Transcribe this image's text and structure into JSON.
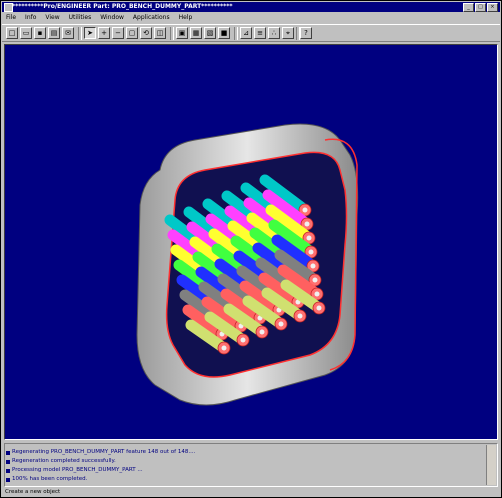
{
  "window": {
    "title": "**********Pro/ENGINEER Part: PRO_BENCH_DUMMY_PART**********",
    "controls": [
      "_",
      "□",
      "×"
    ]
  },
  "menubar": [
    "File",
    "Info",
    "View",
    "Utilities",
    "Window",
    "Applications",
    "Help"
  ],
  "toolbar": {
    "buttons": [
      {
        "name": "new-icon",
        "glyph": "□"
      },
      {
        "name": "open-icon",
        "glyph": "▭"
      },
      {
        "name": "save-icon",
        "glyph": "▪"
      },
      {
        "name": "print-icon",
        "glyph": "▤"
      },
      {
        "name": "mail-icon",
        "glyph": "✉"
      },
      {
        "name": "select-arrow-icon",
        "glyph": "➤"
      },
      {
        "name": "zoom-in-icon",
        "glyph": "+"
      },
      {
        "name": "zoom-out-icon",
        "glyph": "−"
      },
      {
        "name": "refit-icon",
        "glyph": "▢"
      },
      {
        "name": "orient-icon",
        "glyph": "⟲"
      },
      {
        "name": "saved-view-icon",
        "glyph": "◫"
      },
      {
        "name": "wireframe-icon",
        "glyph": "▣"
      },
      {
        "name": "hidden-line-icon",
        "glyph": "▦"
      },
      {
        "name": "no-hidden-icon",
        "glyph": "▧"
      },
      {
        "name": "shading-icon",
        "glyph": "■"
      },
      {
        "name": "datum-planes-icon",
        "glyph": "⊿"
      },
      {
        "name": "datum-axes-icon",
        "glyph": "≡"
      },
      {
        "name": "datum-points-icon",
        "glyph": "∴"
      },
      {
        "name": "coordinate-systems-icon",
        "glyph": "⌖"
      },
      {
        "name": "context-help-icon",
        "glyph": "?"
      }
    ]
  },
  "messages": [
    "Regenerating PRO_BENCH_DUMMY_PART feature 148 out of 148....",
    "Regeneration completed successfully.",
    "Processing model PRO_BENCH_DUMMY_PART ...",
    "100% has been completed."
  ],
  "status": "Create a new object",
  "colors": {
    "viewport_bg": "#000080",
    "title_bg": "#000080",
    "tube_colors": [
      "#00c8c8",
      "#ff40ff",
      "#ffff30",
      "#40ff40",
      "#2030ff",
      "#808080",
      "#ff6060",
      "#d0e070"
    ]
  }
}
